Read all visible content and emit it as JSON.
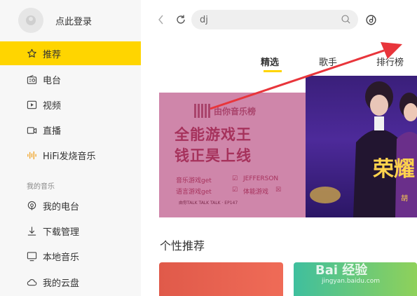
{
  "user": {
    "login_text": "点此登录"
  },
  "sidebar": {
    "items": [
      {
        "label": "推荐",
        "icon": "star-icon"
      },
      {
        "label": "电台",
        "icon": "radio-icon"
      },
      {
        "label": "视频",
        "icon": "video-icon"
      },
      {
        "label": "直播",
        "icon": "live-icon"
      },
      {
        "label": "HiFi发烧音乐",
        "icon": "hifi-icon"
      }
    ],
    "section_title": "我的音乐",
    "my_items": [
      {
        "label": "我的电台",
        "icon": "podcast-icon"
      },
      {
        "label": "下载管理",
        "icon": "download-icon"
      },
      {
        "label": "本地音乐",
        "icon": "monitor-icon"
      },
      {
        "label": "我的云盘",
        "icon": "cloud-icon"
      }
    ]
  },
  "search": {
    "value": "dj"
  },
  "tabs": [
    "精选",
    "歌手",
    "排行榜"
  ],
  "banner_left": {
    "logo": "由你音乐榜",
    "line1": "全能游戏王",
    "line2": "钱正昊上线",
    "tag1": "音乐游戏get",
    "tag2": "语言游戏get",
    "tag3": "体能游戏",
    "name": "JEFFERSON",
    "footer": "由你TALK TALK TALK · EP147"
  },
  "banner_right": {
    "title": "荣耀",
    "sub": "胡"
  },
  "recommend_title": "个性推荐",
  "watermark": {
    "text": "Bai 经验",
    "url": "jingyan.baidu.com"
  },
  "colors": {
    "accent": "#ffd500",
    "annotation_arrow": "#e8353b"
  }
}
